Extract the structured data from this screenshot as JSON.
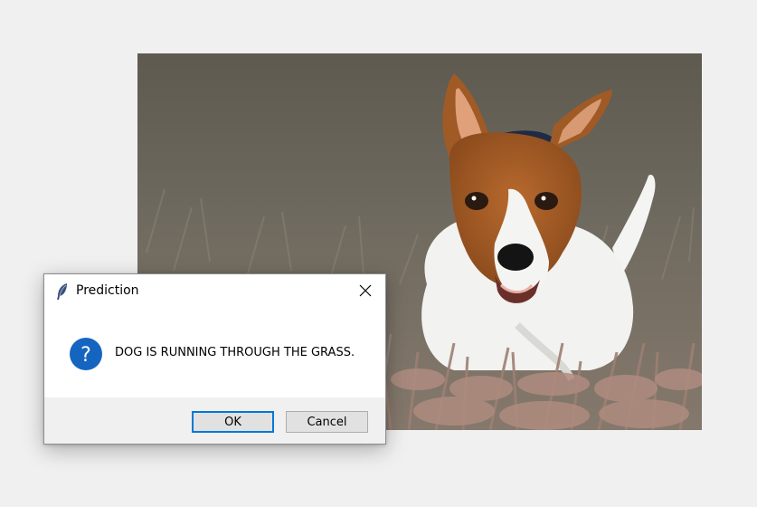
{
  "dialog": {
    "title": "Prediction",
    "message": "DOG IS RUNNING THROUGH THE GRASS.",
    "ok_label": "OK",
    "cancel_label": "Cancel",
    "title_icon": "feather-icon",
    "message_icon": "question-icon",
    "close_icon": "close-icon"
  },
  "colors": {
    "accent": "#0078d7",
    "question_icon": "#1565c0",
    "dialog_bg": "#ffffff",
    "footer_bg": "#f0f0f0",
    "page_bg": "#f0f0f0"
  }
}
